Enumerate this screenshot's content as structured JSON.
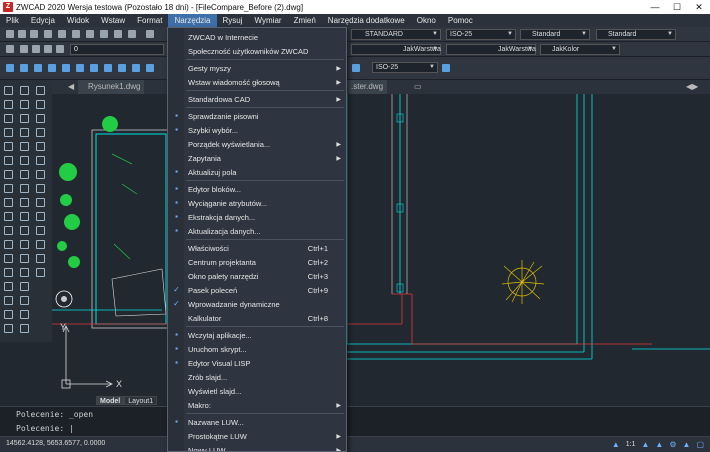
{
  "window": {
    "title": "ZWCAD 2020 Wersja testowa (Pozostało 18 dni) - [FileCompare_Before (2).dwg]",
    "minimize": "—",
    "maximize": "☐",
    "close": "✕"
  },
  "menubar": [
    "Plik",
    "Edycja",
    "Widok",
    "Wstaw",
    "Format",
    "Narzędzia",
    "Rysuj",
    "Wymiar",
    "Zmień",
    "Narzędzia dodatkowe",
    "Okno",
    "Pomoc"
  ],
  "toolbar": {
    "text_style": "STANDARD",
    "dim_style": "ISO-25",
    "table_style": "Standard",
    "multileader_style": "Standard",
    "layer_value": "0",
    "linetype": "JakWarstwa",
    "lineweight": "JakWarstwa",
    "color": "JakKolor",
    "dim_style_2": "ISO-25"
  },
  "doc_tabs": {
    "tab1": "Rysunek1.dwg",
    "tab2": ".ster.dwg"
  },
  "layout_tabs": {
    "model": "Model",
    "layout1": "Layout1"
  },
  "command": {
    "history": "Polecenie: _open",
    "prompt": "Polecenie:"
  },
  "status": {
    "coords": "14562.4128, 5653.6577, 0.0000",
    "scale": "1:1"
  },
  "axis": {
    "y": "Y",
    "x": "X"
  },
  "menu": {
    "items": [
      {
        "label": "ZWCAD w Internecie",
        "icon": "",
        "shortcut": "",
        "sub": false
      },
      {
        "label": "Społeczność użytkowników ZWCAD",
        "icon": "",
        "shortcut": "",
        "sub": false
      },
      {
        "label": "Gesty myszy",
        "icon": "",
        "shortcut": "",
        "sub": true
      },
      {
        "label": "Wstaw wiadomość głosową",
        "icon": "",
        "shortcut": "",
        "sub": true
      },
      {
        "label": "Standardowa CAD",
        "icon": "",
        "shortcut": "",
        "sub": true
      },
      {
        "label": "Sprawdzanie pisowni",
        "icon": "abc",
        "shortcut": "",
        "sub": false
      },
      {
        "label": "Szybki wybór...",
        "icon": "qs",
        "shortcut": "",
        "sub": false
      },
      {
        "label": "Porządek wyświetlania...",
        "icon": "",
        "shortcut": "",
        "sub": true
      },
      {
        "label": "Zapytania",
        "icon": "",
        "shortcut": "",
        "sub": true
      },
      {
        "label": "Aktualizuj pola",
        "icon": "fld",
        "shortcut": "",
        "sub": false
      },
      {
        "label": "Edytor bloków...",
        "icon": "blk",
        "shortcut": "",
        "sub": false
      },
      {
        "label": "Wyciąganie atrybutów...",
        "icon": "att",
        "shortcut": "",
        "sub": false
      },
      {
        "label": "Ekstrakcja danych...",
        "icon": "ext",
        "shortcut": "",
        "sub": false
      },
      {
        "label": "Aktualizacja danych...",
        "icon": "upd",
        "shortcut": "",
        "sub": false
      },
      {
        "label": "Właściwości",
        "icon": "",
        "shortcut": "Ctrl+1",
        "sub": false
      },
      {
        "label": "Centrum projektanta",
        "icon": "",
        "shortcut": "Ctrl+2",
        "sub": false
      },
      {
        "label": "Okno palety narzędzi",
        "icon": "",
        "shortcut": "Ctrl+3",
        "sub": false
      },
      {
        "label": "Pasek poleceń",
        "icon": "check",
        "shortcut": "Ctrl+9",
        "sub": false
      },
      {
        "label": "Wprowadzanie dynamiczne",
        "icon": "check",
        "shortcut": "",
        "sub": false
      },
      {
        "label": "Kalkulator",
        "icon": "",
        "shortcut": "Ctrl+8",
        "sub": false
      },
      {
        "label": "Wczytaj aplikacje...",
        "icon": "app",
        "shortcut": "",
        "sub": false
      },
      {
        "label": "Uruchom skrypt...",
        "icon": "scr",
        "shortcut": "",
        "sub": false
      },
      {
        "label": "Edytor Visual LISP",
        "icon": "lsp",
        "shortcut": "",
        "sub": false
      },
      {
        "label": "Zrób slajd...",
        "icon": "",
        "shortcut": "",
        "sub": false
      },
      {
        "label": "Wyświetl slajd...",
        "icon": "",
        "shortcut": "",
        "sub": false
      },
      {
        "label": "Makro:",
        "icon": "",
        "shortcut": "",
        "sub": true
      },
      {
        "label": "Nazwane LUW...",
        "icon": "ucs",
        "shortcut": "",
        "sub": false
      },
      {
        "label": "Prostokątne LUW",
        "icon": "",
        "shortcut": "",
        "sub": true
      },
      {
        "label": "Nowy LUW",
        "icon": "",
        "shortcut": "",
        "sub": true
      }
    ]
  },
  "colors": {
    "accent": "#3d6fa8",
    "check": "#6fb3ff",
    "cyan": "#00e5e5",
    "green": "#22cc44",
    "red": "#e53935",
    "yellow": "#e0c000"
  }
}
